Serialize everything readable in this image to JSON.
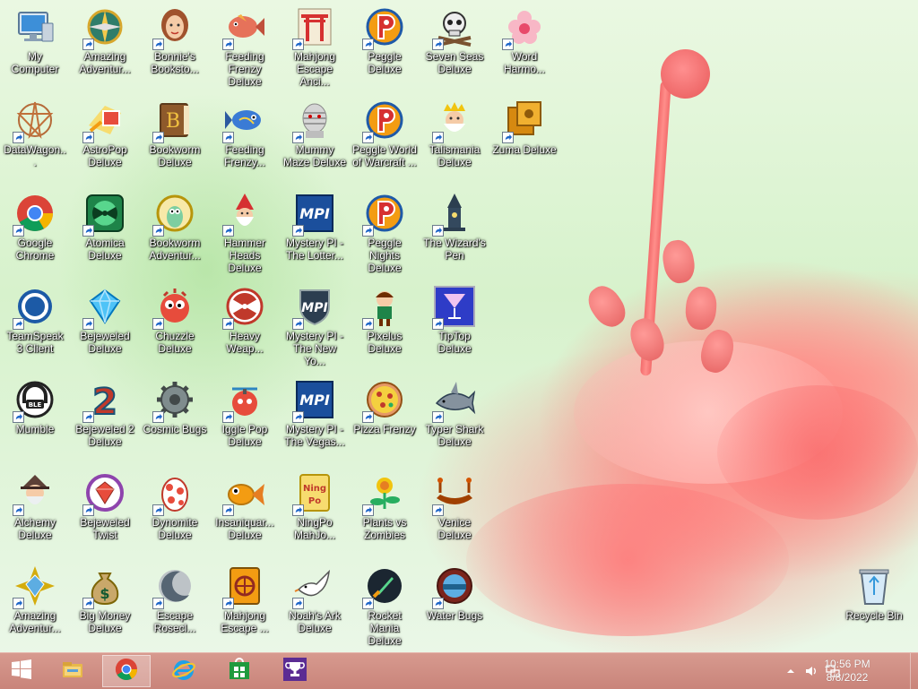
{
  "desktop": {
    "icons": [
      {
        "label": "My Computer",
        "icon": "computer-icon",
        "shortcut": false
      },
      {
        "label": "Amazing Adventur...",
        "icon": "compass-icon",
        "shortcut": true
      },
      {
        "label": "Bonnie's Booksto...",
        "icon": "girl-face-icon",
        "shortcut": true
      },
      {
        "label": "Feeding Frenzy Deluxe",
        "icon": "fish-icon",
        "shortcut": true
      },
      {
        "label": "Mahjong Escape Anci...",
        "icon": "torii-gate-icon",
        "shortcut": true
      },
      {
        "label": "Peggle Deluxe",
        "icon": "peggle-p-icon",
        "shortcut": true
      },
      {
        "label": "Seven Seas Deluxe",
        "icon": "skull-icon",
        "shortcut": true
      },
      {
        "label": "Word Harmo...",
        "icon": "flower-icon",
        "shortcut": true
      },
      {
        "label": "DataWagon...",
        "icon": "star-pattern-icon",
        "shortcut": true
      },
      {
        "label": "AstroPop Deluxe",
        "icon": "astropop-icon",
        "shortcut": true
      },
      {
        "label": "Bookworm Deluxe",
        "icon": "book-icon",
        "shortcut": true
      },
      {
        "label": "Feeding Frenzy...",
        "icon": "fish-blue-icon",
        "shortcut": true
      },
      {
        "label": "Mummy Maze Deluxe",
        "icon": "mummy-icon",
        "shortcut": true
      },
      {
        "label": "Peggle World of Warcraft ...",
        "icon": "peggle-p-icon",
        "shortcut": true
      },
      {
        "label": "Talismania Deluxe",
        "icon": "king-icon",
        "shortcut": true
      },
      {
        "label": "Zuma Deluxe",
        "icon": "zuma-icon",
        "shortcut": true
      },
      {
        "label": "Google Chrome",
        "icon": "chrome-icon",
        "shortcut": true
      },
      {
        "label": "Atomica Deluxe",
        "icon": "radiation-icon",
        "shortcut": true
      },
      {
        "label": "Bookworm Adventur...",
        "icon": "worm-icon",
        "shortcut": true
      },
      {
        "label": "Hammer Heads Deluxe",
        "icon": "gnome-icon",
        "shortcut": true
      },
      {
        "label": "Mystery PI - The Lotter...",
        "icon": "mpi-icon",
        "shortcut": true
      },
      {
        "label": "Peggle Nights Deluxe",
        "icon": "peggle-p-icon",
        "shortcut": true
      },
      {
        "label": "The Wizard's Pen",
        "icon": "wizard-tower-icon",
        "shortcut": true
      },
      {
        "label": "TeamSpeak 3 Client",
        "icon": "teamspeak-icon",
        "shortcut": true
      },
      {
        "label": "Bejeweled Deluxe",
        "icon": "diamond-icon",
        "shortcut": true
      },
      {
        "label": "Chuzzle Deluxe",
        "icon": "chuzzle-icon",
        "shortcut": true
      },
      {
        "label": "Heavy Weap...",
        "icon": "radiation-red-icon",
        "shortcut": true
      },
      {
        "label": "Mystery PI - The New Yo...",
        "icon": "mpi-shield-icon",
        "shortcut": true
      },
      {
        "label": "Pixelus Deluxe",
        "icon": "explorer-icon",
        "shortcut": true
      },
      {
        "label": "TipTop Deluxe",
        "icon": "cocktail-icon",
        "shortcut": true
      },
      {
        "label": "Mumble",
        "icon": "mumble-icon",
        "shortcut": true
      },
      {
        "label": "Bejeweled 2 Deluxe",
        "icon": "number-two-icon",
        "shortcut": true
      },
      {
        "label": "Cosmic Bugs",
        "icon": "gear-icon",
        "shortcut": true
      },
      {
        "label": "Iggle Pop Deluxe",
        "icon": "iggle-icon",
        "shortcut": true
      },
      {
        "label": "Mystery PI - The Vegas...",
        "icon": "mpi-icon",
        "shortcut": true
      },
      {
        "label": "Pizza Frenzy",
        "icon": "pizza-icon",
        "shortcut": true
      },
      {
        "label": "Typer Shark Deluxe",
        "icon": "shark-icon",
        "shortcut": true
      },
      {
        "label": "Alchemy Deluxe",
        "icon": "alchemist-icon",
        "shortcut": true
      },
      {
        "label": "Bejeweled Twist",
        "icon": "gem-twist-icon",
        "shortcut": true
      },
      {
        "label": "Dynomite Deluxe",
        "icon": "egg-icon",
        "shortcut": true
      },
      {
        "label": "Insaniquar... Deluxe",
        "icon": "goldfish-icon",
        "shortcut": true
      },
      {
        "label": "NingPo MahJo...",
        "icon": "tile-icon",
        "shortcut": true
      },
      {
        "label": "Plants vs Zombies",
        "icon": "plant-icon",
        "shortcut": true
      },
      {
        "label": "Venice Deluxe",
        "icon": "gondola-icon",
        "shortcut": true
      },
      {
        "label": "Amazing Adventur...",
        "icon": "gem-compass-icon",
        "shortcut": true
      },
      {
        "label": "Big Money Deluxe",
        "icon": "money-bag-icon",
        "shortcut": true
      },
      {
        "label": "Escape Rosecl...",
        "icon": "moon-icon",
        "shortcut": true
      },
      {
        "label": "Mahjong Escape ...",
        "icon": "mahjong-tile-icon",
        "shortcut": true
      },
      {
        "label": "Noah's Ark Deluxe",
        "icon": "dove-icon",
        "shortcut": true
      },
      {
        "label": "Rocket Mania Deluxe",
        "icon": "rocket-icon",
        "shortcut": true
      },
      {
        "label": "Water Bugs",
        "icon": "porthole-icon",
        "shortcut": true
      },
      {
        "label": "Recycle Bin",
        "icon": "recycle-bin-icon",
        "shortcut": false
      }
    ]
  },
  "taskbar": {
    "start_icon": "windows-logo-icon",
    "pinned": [
      {
        "icon": "file-explorer-icon"
      },
      {
        "icon": "chrome-icon",
        "active": true
      },
      {
        "icon": "internet-explorer-icon"
      },
      {
        "icon": "store-icon"
      },
      {
        "icon": "trophy-icon"
      }
    ],
    "tray": {
      "chevron_icon": "chevron-up-icon",
      "volume_icon": "speaker-icon",
      "network_icon": "network-icon",
      "time": "10:56 PM",
      "date": "8/8/2022"
    }
  }
}
